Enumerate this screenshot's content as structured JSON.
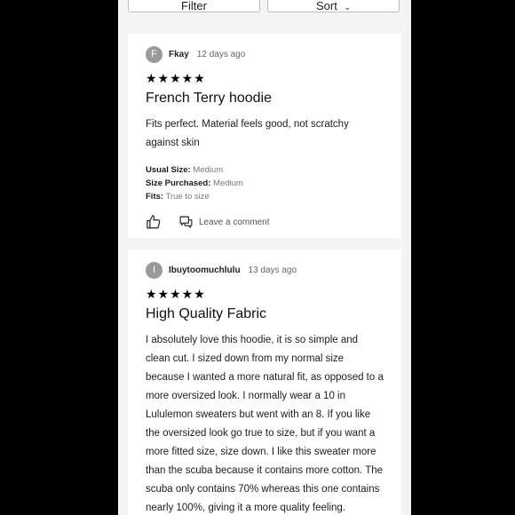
{
  "toolbar": {
    "filter_label": "Filter",
    "sort_label": "Sort",
    "sort_icon": "chevron-down-icon"
  },
  "reviews": [
    {
      "avatar_letter": "F",
      "author": "Fkay",
      "time": "12 days ago",
      "stars": "★★★★★",
      "rating": 5,
      "title": "French Terry hoodie",
      "body": "Fits perfect. Material feels good, not scratchy against skin",
      "usual_size_label": "Usual Size:",
      "usual_size": "Medium",
      "size_purchased_label": "Size Purchased:",
      "size_purchased": "Medium",
      "fits_label": "Fits:",
      "fits": "True to size",
      "comment_label": "Leave a comment"
    },
    {
      "avatar_letter": "I",
      "author": "Ibuytoomuchlulu",
      "time": "13 days ago",
      "stars": "★★★★★",
      "rating": 5,
      "title": "High Quality Fabric",
      "body": "I absolutely love this hoodie, it is so simple and clean cut. I sized down from my normal size because I wanted a more natural fit, as opposed to a more oversized look. I normally wear a 10 in Lululemon sweaters but went with an 8. If you like the oversized look go true to size, but if you want a more fitted size, size down. I like this sweater more than the scuba because it contains more cotton. The scuba only contains 70% whereas this one contains nearly 100%, giving it a more quality feeling."
    }
  ]
}
